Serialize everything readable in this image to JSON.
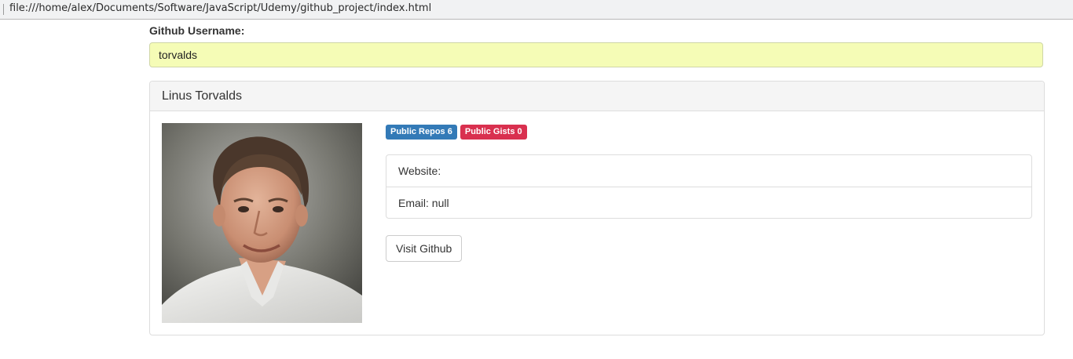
{
  "browser": {
    "url": "file:///home/alex/Documents/Software/JavaScript/Udemy/github_project/index.html"
  },
  "search": {
    "label": "Github Username:",
    "value": "torvalds"
  },
  "profile": {
    "name": "Linus Torvalds",
    "avatar_alt": "Linus Torvalds avatar",
    "badges": {
      "repos": "Public Repos 6",
      "gists": "Public Gists 0"
    },
    "details": {
      "website": "Website:",
      "email": "Email: null"
    },
    "visit_label": "Visit Github"
  },
  "colors": {
    "input_background": "#f5fcb6",
    "repos_badge": "#337ab7",
    "gists_badge": "#d9304f",
    "panel_heading": "#f5f5f5"
  }
}
